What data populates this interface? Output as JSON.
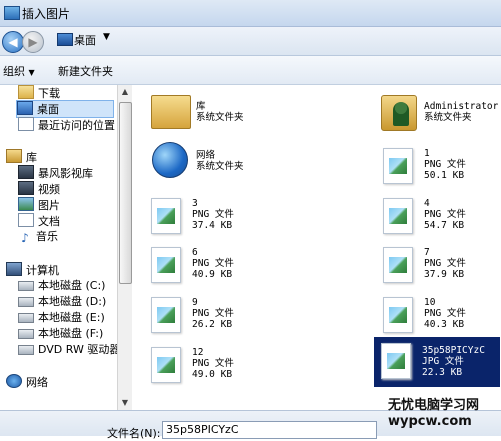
{
  "window": {
    "title": "插入图片"
  },
  "address": {
    "location": "桌面"
  },
  "toolbar": {
    "organize": "组织",
    "new_folder": "新建文件夹"
  },
  "sidebar": {
    "items": [
      {
        "label": "下载",
        "icon": "folder-icon"
      },
      {
        "label": "桌面",
        "icon": "desktop-icon",
        "selected": true
      },
      {
        "label": "最近访问的位置",
        "icon": "recent-icon"
      },
      {
        "label": "库",
        "icon": "library-icon"
      },
      {
        "label": "暴风影视库",
        "icon": "video-library-icon"
      },
      {
        "label": "视频",
        "icon": "video-icon"
      },
      {
        "label": "图片",
        "icon": "picture-icon"
      },
      {
        "label": "文档",
        "icon": "document-icon"
      },
      {
        "label": "音乐",
        "icon": "music-icon"
      },
      {
        "label": "计算机",
        "icon": "computer-icon"
      },
      {
        "label": "本地磁盘 (C:)",
        "icon": "drive-icon"
      },
      {
        "label": "本地磁盘 (D:)",
        "icon": "drive-icon"
      },
      {
        "label": "本地磁盘 (E:)",
        "icon": "drive-icon"
      },
      {
        "label": "本地磁盘 (F:)",
        "icon": "drive-icon"
      },
      {
        "label": "DVD RW 驱动器 (",
        "icon": "dvd-drive-icon"
      },
      {
        "label": "网络",
        "icon": "network-icon"
      }
    ]
  },
  "files": [
    {
      "name": "库",
      "line2": "系统文件夹",
      "line3": "",
      "kind": "library"
    },
    {
      "name": "Administrator",
      "line2": "系统文件夹",
      "line3": "",
      "kind": "user"
    },
    {
      "name": "网络",
      "line2": "系统文件夹",
      "line3": "",
      "kind": "network"
    },
    {
      "name": "1",
      "line2": "PNG 文件",
      "line3": "50.1 KB",
      "kind": "png"
    },
    {
      "name": "3",
      "line2": "PNG 文件",
      "line3": "37.4 KB",
      "kind": "png"
    },
    {
      "name": "4",
      "line2": "PNG 文件",
      "line3": "54.7 KB",
      "kind": "png"
    },
    {
      "name": "6",
      "line2": "PNG 文件",
      "line3": "40.9 KB",
      "kind": "png"
    },
    {
      "name": "7",
      "line2": "PNG 文件",
      "line3": "37.9 KB",
      "kind": "png"
    },
    {
      "name": "9",
      "line2": "PNG 文件",
      "line3": "26.2 KB",
      "kind": "png"
    },
    {
      "name": "10",
      "line2": "PNG 文件",
      "line3": "40.3 KB",
      "kind": "png"
    },
    {
      "name": "12",
      "line2": "PNG 文件",
      "line3": "49.0 KB",
      "kind": "png"
    },
    {
      "name": "35p58PICYzC",
      "line2": "JPG 文件",
      "line3": "22.3 KB",
      "kind": "jpg",
      "selected": true
    }
  ],
  "footer": {
    "filename_label": "文件名(N):",
    "filename_value": "35p58PICYzC"
  },
  "watermark": {
    "line1": "无忧电脑学习网",
    "line2": "wypcw.com"
  }
}
